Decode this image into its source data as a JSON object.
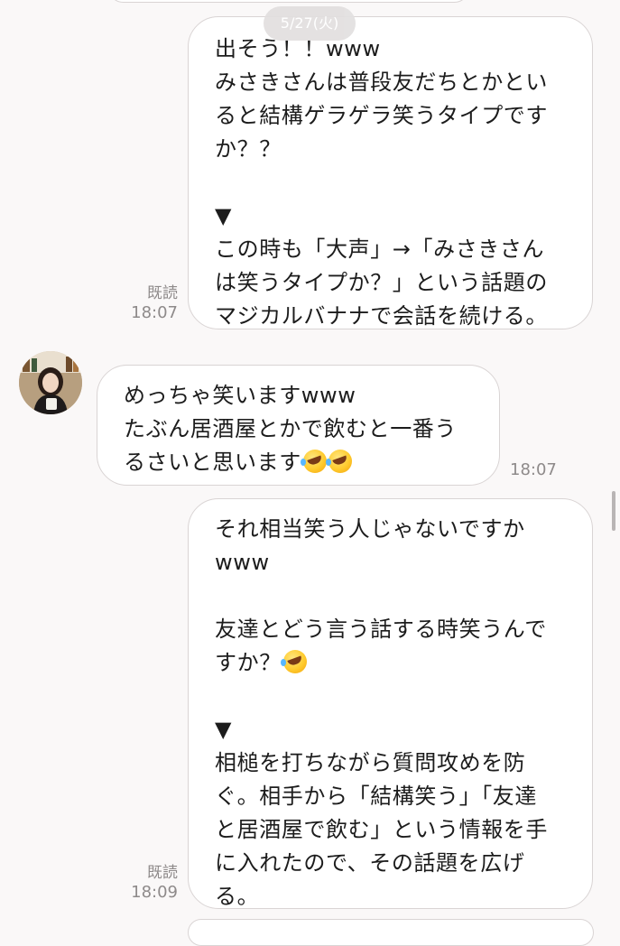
{
  "date_divider": "5/27(火)",
  "messages": [
    {
      "side": "sent",
      "lines": [
        "出そう！！www",
        "みさきさんは普段友だちとかとい",
        "ると結構ゲラゲラ笑うタイプです",
        "か？？",
        "",
        "▼",
        "この時も「大声」→「みさきさん",
        "は笑うタイプか？」という話題の",
        "マジカルバナナで会話を続ける。"
      ],
      "read_label": "既読",
      "time": "18:07"
    },
    {
      "side": "received",
      "lines": [
        "めっちゃ笑いますwww",
        "たぶん居酒屋とかで飲むと一番う",
        "るさいと思います"
      ],
      "trailing_emoji": [
        "rolling-on-floor-laughing",
        "rolling-on-floor-laughing"
      ],
      "time": "18:07"
    },
    {
      "side": "sent",
      "lines": [
        "それ相当笑う人じゃないですか",
        "www",
        "",
        "友達とどう言う話する時笑うんで",
        "すか？",
        "",
        "▼",
        "相槌を打ちながら質問攻めを防",
        "ぐ。相手から「結構笑う」「友達",
        "と居酒屋で飲む」という情報を手",
        "に入れたので、その話題を広げ",
        "る。"
      ],
      "emoji_after_line": {
        "line": 4,
        "emoji": "rolling-on-floor-laughing"
      },
      "read_label": "既読",
      "time": "18:09"
    }
  ],
  "colors": {
    "background": "#faf8f8",
    "bubble": "#ffffff",
    "bubble_border": "#d9d4d4",
    "meta_text": "#8e8a8a",
    "date_pill": "#e2dfdf"
  }
}
